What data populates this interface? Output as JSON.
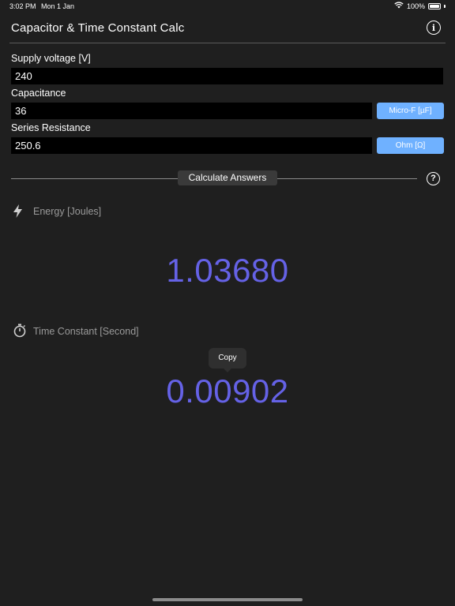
{
  "status_bar": {
    "time": "3:02 PM",
    "date": "Mon 1 Jan",
    "battery": "100%"
  },
  "header": {
    "title": "Capacitor & Time Constant Calc",
    "info_icon": "info-circle-icon"
  },
  "form": {
    "voltage": {
      "label": "Supply voltage [V]",
      "value": "240"
    },
    "capacitance": {
      "label": "Capacitance",
      "value": "36",
      "unit": "Micro-F [µF]"
    },
    "resistance": {
      "label": "Series Resistance",
      "value": "250.6",
      "unit": "Ohm [Ω]"
    }
  },
  "calculate": {
    "label": "Calculate Answers",
    "help_icon": "question-circle-icon"
  },
  "results": {
    "energy": {
      "label": "Energy [Joules]",
      "value": "1.03680",
      "icon": "lightning-bolt-icon"
    },
    "time_constant": {
      "label": "Time Constant [Second]",
      "value": "0.00902",
      "icon": "stopwatch-icon"
    }
  },
  "tooltip": {
    "label": "Copy"
  },
  "colors": {
    "background": "#1f1f1f",
    "accent_value": "#6562e6",
    "unit_button": "#6fb1ff"
  }
}
